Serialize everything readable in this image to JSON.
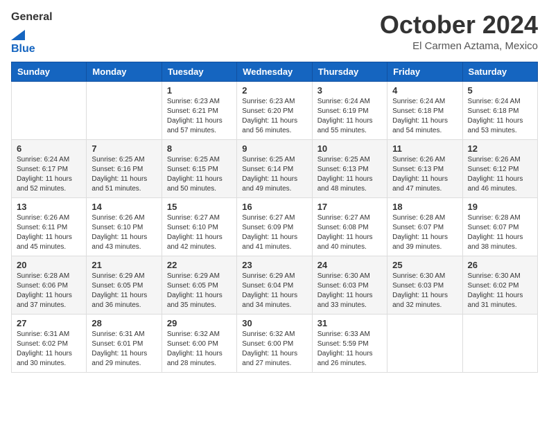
{
  "header": {
    "logo_general": "General",
    "logo_blue": "Blue",
    "month_title": "October 2024",
    "location": "El Carmen Aztama, Mexico"
  },
  "weekdays": [
    "Sunday",
    "Monday",
    "Tuesday",
    "Wednesday",
    "Thursday",
    "Friday",
    "Saturday"
  ],
  "weeks": [
    [
      {
        "day": "",
        "sunrise": "",
        "sunset": "",
        "daylight": ""
      },
      {
        "day": "",
        "sunrise": "",
        "sunset": "",
        "daylight": ""
      },
      {
        "day": "1",
        "sunrise": "Sunrise: 6:23 AM",
        "sunset": "Sunset: 6:21 PM",
        "daylight": "Daylight: 11 hours and 57 minutes."
      },
      {
        "day": "2",
        "sunrise": "Sunrise: 6:23 AM",
        "sunset": "Sunset: 6:20 PM",
        "daylight": "Daylight: 11 hours and 56 minutes."
      },
      {
        "day": "3",
        "sunrise": "Sunrise: 6:24 AM",
        "sunset": "Sunset: 6:19 PM",
        "daylight": "Daylight: 11 hours and 55 minutes."
      },
      {
        "day": "4",
        "sunrise": "Sunrise: 6:24 AM",
        "sunset": "Sunset: 6:18 PM",
        "daylight": "Daylight: 11 hours and 54 minutes."
      },
      {
        "day": "5",
        "sunrise": "Sunrise: 6:24 AM",
        "sunset": "Sunset: 6:18 PM",
        "daylight": "Daylight: 11 hours and 53 minutes."
      }
    ],
    [
      {
        "day": "6",
        "sunrise": "Sunrise: 6:24 AM",
        "sunset": "Sunset: 6:17 PM",
        "daylight": "Daylight: 11 hours and 52 minutes."
      },
      {
        "day": "7",
        "sunrise": "Sunrise: 6:25 AM",
        "sunset": "Sunset: 6:16 PM",
        "daylight": "Daylight: 11 hours and 51 minutes."
      },
      {
        "day": "8",
        "sunrise": "Sunrise: 6:25 AM",
        "sunset": "Sunset: 6:15 PM",
        "daylight": "Daylight: 11 hours and 50 minutes."
      },
      {
        "day": "9",
        "sunrise": "Sunrise: 6:25 AM",
        "sunset": "Sunset: 6:14 PM",
        "daylight": "Daylight: 11 hours and 49 minutes."
      },
      {
        "day": "10",
        "sunrise": "Sunrise: 6:25 AM",
        "sunset": "Sunset: 6:13 PM",
        "daylight": "Daylight: 11 hours and 48 minutes."
      },
      {
        "day": "11",
        "sunrise": "Sunrise: 6:26 AM",
        "sunset": "Sunset: 6:13 PM",
        "daylight": "Daylight: 11 hours and 47 minutes."
      },
      {
        "day": "12",
        "sunrise": "Sunrise: 6:26 AM",
        "sunset": "Sunset: 6:12 PM",
        "daylight": "Daylight: 11 hours and 46 minutes."
      }
    ],
    [
      {
        "day": "13",
        "sunrise": "Sunrise: 6:26 AM",
        "sunset": "Sunset: 6:11 PM",
        "daylight": "Daylight: 11 hours and 45 minutes."
      },
      {
        "day": "14",
        "sunrise": "Sunrise: 6:26 AM",
        "sunset": "Sunset: 6:10 PM",
        "daylight": "Daylight: 11 hours and 43 minutes."
      },
      {
        "day": "15",
        "sunrise": "Sunrise: 6:27 AM",
        "sunset": "Sunset: 6:10 PM",
        "daylight": "Daylight: 11 hours and 42 minutes."
      },
      {
        "day": "16",
        "sunrise": "Sunrise: 6:27 AM",
        "sunset": "Sunset: 6:09 PM",
        "daylight": "Daylight: 11 hours and 41 minutes."
      },
      {
        "day": "17",
        "sunrise": "Sunrise: 6:27 AM",
        "sunset": "Sunset: 6:08 PM",
        "daylight": "Daylight: 11 hours and 40 minutes."
      },
      {
        "day": "18",
        "sunrise": "Sunrise: 6:28 AM",
        "sunset": "Sunset: 6:07 PM",
        "daylight": "Daylight: 11 hours and 39 minutes."
      },
      {
        "day": "19",
        "sunrise": "Sunrise: 6:28 AM",
        "sunset": "Sunset: 6:07 PM",
        "daylight": "Daylight: 11 hours and 38 minutes."
      }
    ],
    [
      {
        "day": "20",
        "sunrise": "Sunrise: 6:28 AM",
        "sunset": "Sunset: 6:06 PM",
        "daylight": "Daylight: 11 hours and 37 minutes."
      },
      {
        "day": "21",
        "sunrise": "Sunrise: 6:29 AM",
        "sunset": "Sunset: 6:05 PM",
        "daylight": "Daylight: 11 hours and 36 minutes."
      },
      {
        "day": "22",
        "sunrise": "Sunrise: 6:29 AM",
        "sunset": "Sunset: 6:05 PM",
        "daylight": "Daylight: 11 hours and 35 minutes."
      },
      {
        "day": "23",
        "sunrise": "Sunrise: 6:29 AM",
        "sunset": "Sunset: 6:04 PM",
        "daylight": "Daylight: 11 hours and 34 minutes."
      },
      {
        "day": "24",
        "sunrise": "Sunrise: 6:30 AM",
        "sunset": "Sunset: 6:03 PM",
        "daylight": "Daylight: 11 hours and 33 minutes."
      },
      {
        "day": "25",
        "sunrise": "Sunrise: 6:30 AM",
        "sunset": "Sunset: 6:03 PM",
        "daylight": "Daylight: 11 hours and 32 minutes."
      },
      {
        "day": "26",
        "sunrise": "Sunrise: 6:30 AM",
        "sunset": "Sunset: 6:02 PM",
        "daylight": "Daylight: 11 hours and 31 minutes."
      }
    ],
    [
      {
        "day": "27",
        "sunrise": "Sunrise: 6:31 AM",
        "sunset": "Sunset: 6:02 PM",
        "daylight": "Daylight: 11 hours and 30 minutes."
      },
      {
        "day": "28",
        "sunrise": "Sunrise: 6:31 AM",
        "sunset": "Sunset: 6:01 PM",
        "daylight": "Daylight: 11 hours and 29 minutes."
      },
      {
        "day": "29",
        "sunrise": "Sunrise: 6:32 AM",
        "sunset": "Sunset: 6:00 PM",
        "daylight": "Daylight: 11 hours and 28 minutes."
      },
      {
        "day": "30",
        "sunrise": "Sunrise: 6:32 AM",
        "sunset": "Sunset: 6:00 PM",
        "daylight": "Daylight: 11 hours and 27 minutes."
      },
      {
        "day": "31",
        "sunrise": "Sunrise: 6:33 AM",
        "sunset": "Sunset: 5:59 PM",
        "daylight": "Daylight: 11 hours and 26 minutes."
      },
      {
        "day": "",
        "sunrise": "",
        "sunset": "",
        "daylight": ""
      },
      {
        "day": "",
        "sunrise": "",
        "sunset": "",
        "daylight": ""
      }
    ]
  ]
}
